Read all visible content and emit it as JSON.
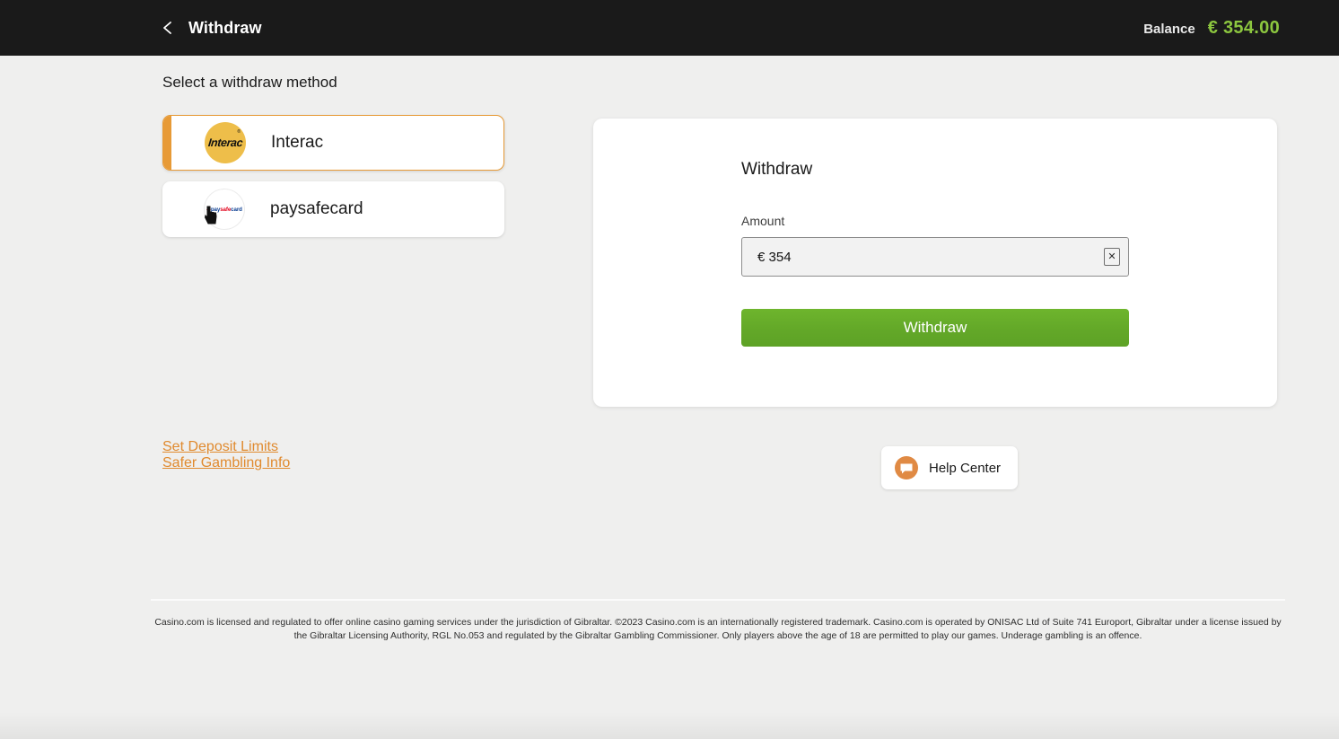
{
  "topbar": {
    "back_icon": "chevron-left-icon",
    "title": "Withdraw",
    "balance_label": "Balance",
    "balance_amount": "€ 354.00",
    "balance_color": "#8cc63f",
    "background": "#1a1a1a"
  },
  "main": {
    "section_title": "Select a withdraw method",
    "methods": [
      {
        "name": "Interac",
        "logo": "interac-logo",
        "logo_text": "Interac",
        "logo_mark": "®",
        "selected": true,
        "accent": "#e79a36"
      },
      {
        "name": "paysafecard",
        "logo": "paysafecard-logo",
        "logo_text_parts": [
          "pay",
          "safe",
          "card"
        ],
        "selected": false
      }
    ]
  },
  "panel": {
    "title": "Withdraw",
    "amount_label": "Amount",
    "amount_value": "€ 354",
    "amount_placeholder": "Amount",
    "clear_icon": "close-icon",
    "clear_glyph": "✕",
    "submit_label": "Withdraw",
    "submit_color": "#63a828"
  },
  "links": [
    {
      "label": "Set Deposit Limits"
    },
    {
      "label": "Safer Gambling Info"
    }
  ],
  "help": {
    "label": "Help Center",
    "icon": "chat-bubble-icon",
    "icon_color": "#e08a44"
  },
  "footer": {
    "text": "Casino.com is licensed and regulated to offer online casino gaming services under the jurisdiction of Gibraltar. ©2023 Casino.com is an internationally registered trademark. Casino.com is operated by ONISAC Ltd of Suite 741 Europort, Gibraltar under a license issued by the Gibraltar Licensing Authority, RGL No.053 and regulated by the Gibraltar Gambling Commissioner. Only players above the age of 18 are permitted to play our games. Underage gambling is an offence."
  }
}
